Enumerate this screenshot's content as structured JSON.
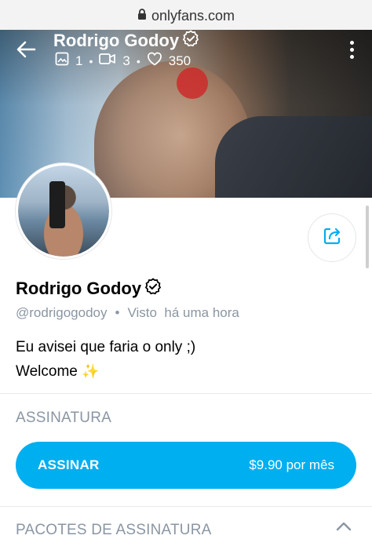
{
  "browser": {
    "url": "onlyfans.com",
    "lock_icon": "lock-icon"
  },
  "header": {
    "title": "Rodrigo Godoy",
    "stats": {
      "photos": "1",
      "videos": "3",
      "likes": "350"
    },
    "icons": [
      "back-arrow-icon",
      "image-icon",
      "video-icon",
      "heart-icon",
      "more-vertical-icon"
    ]
  },
  "profile": {
    "name": "Rodrigo Godoy",
    "handle": "@rodrigogodoy",
    "separator": "•",
    "seen_label": "Visto",
    "seen_time": "há uma hora",
    "bio_line1": "Eu avisei que faria o only ;)",
    "bio_line2": "Welcome",
    "bio_emoji": "✨"
  },
  "subscription": {
    "section_label": "ASSINATURA",
    "button_label": "ASSINAR",
    "price": "$9.90 por mês"
  },
  "bundles": {
    "section_label": "PACOTES DE ASSINATURA"
  },
  "colors": {
    "accent": "#00aff0",
    "muted_text": "#8a96a3",
    "divider": "#e8eaec"
  }
}
